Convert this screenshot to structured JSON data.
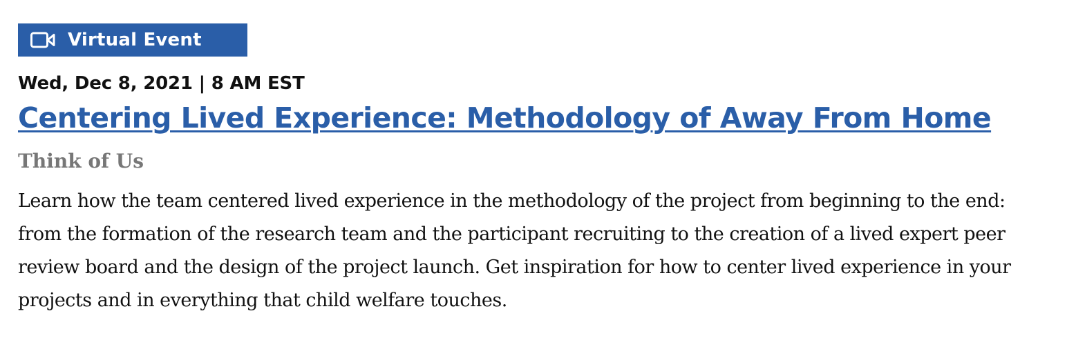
{
  "badge": {
    "icon": "video-camera-icon",
    "label": "Virtual Event",
    "color": "#2a5ea8"
  },
  "event": {
    "datetime": "Wed, Dec 8, 2021 | 8 AM EST",
    "title": "Centering Lived Experience: Methodology of Away From Home",
    "organization": "Think of Us",
    "description": "Learn how the team centered lived experience in the methodology of the project from beginning to the end: from the formation of the research team and the participant recruiting to the creation of a lived expert peer review board and the design of the project launch. Get inspiration for how to center lived experience in your projects and in everything that child welfare touches."
  },
  "colors": {
    "link": "#2a5ea8",
    "muted": "#777777",
    "text": "#111111"
  }
}
